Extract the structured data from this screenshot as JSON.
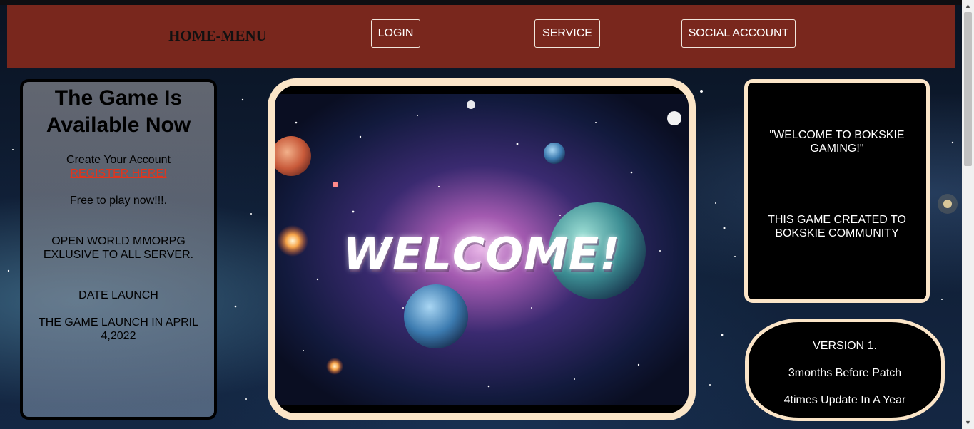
{
  "header": {
    "logo": "HOME-MENU",
    "nav": [
      {
        "label": "LOGIN"
      },
      {
        "label": "SERVICE"
      },
      {
        "label": "SOCIAL ACCOUNT"
      }
    ]
  },
  "left_panel": {
    "title": "The Game Is Available Now",
    "create_account": "Create Your Account",
    "register_link": "REGISTER HERE!",
    "free_text": "Free to play now!!!.",
    "open_world": "OPEN WORLD MMORPG EXLUSIVE TO ALL SERVER.",
    "date_heading": "DATE LAUNCH",
    "launch_text": "THE GAME LAUNCH IN APRIL 4,2022"
  },
  "center": {
    "welcome": "WELCOME!"
  },
  "right_top": {
    "welcome_quote": "\"WELCOME TO BOKSKIE GAMING!\"",
    "community": "THIS GAME CREATED TO BOKSKIE COMMUNITY"
  },
  "right_bottom": {
    "version": "VERSION 1.",
    "patch": "3months Before Patch",
    "updates": "4times Update In A Year"
  },
  "colors": {
    "header_bg": "#79271d",
    "frame_border": "#fbe5c8",
    "link": "#e0351d"
  }
}
